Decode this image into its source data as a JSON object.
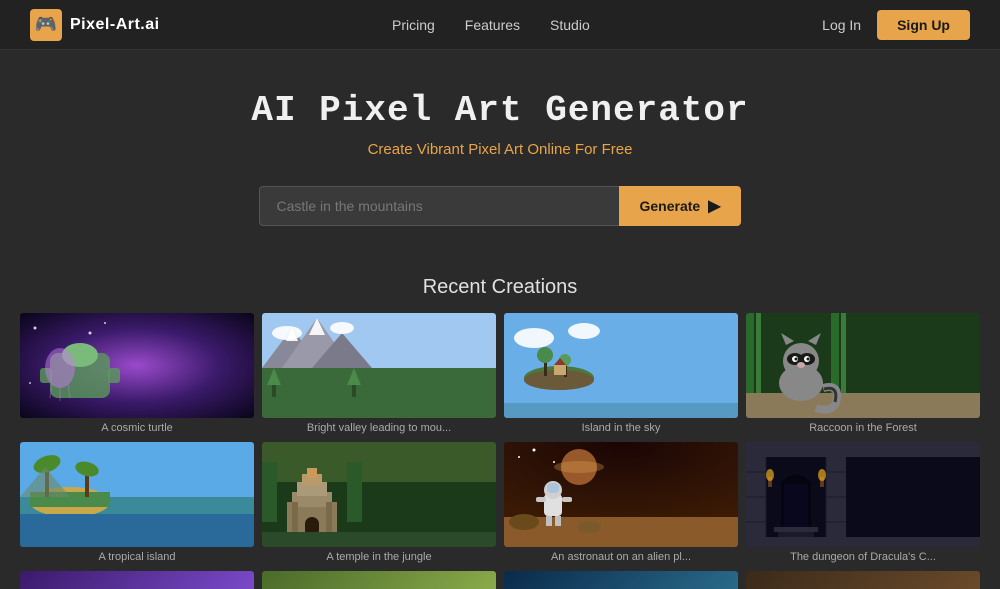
{
  "nav": {
    "logo_text": "Pixel-Art.ai",
    "logo_icon": "🎮",
    "links": [
      {
        "label": "Pricing",
        "id": "pricing"
      },
      {
        "label": "Features",
        "id": "features"
      },
      {
        "label": "Studio",
        "id": "studio"
      }
    ],
    "login_label": "Log In",
    "signup_label": "Sign Up"
  },
  "hero": {
    "title": "AI Pixel Art Generator",
    "subtitle": "Create Vibrant Pixel Art Online For Free",
    "input_placeholder": "Castle in the mountains",
    "generate_label": "Generate"
  },
  "gallery": {
    "title": "Recent Creations",
    "items": [
      {
        "caption": "A cosmic turtle",
        "theme": "cosmic"
      },
      {
        "caption": "Bright valley leading to mou...",
        "theme": "valley"
      },
      {
        "caption": "Island in the sky",
        "theme": "island"
      },
      {
        "caption": "Raccoon in the Forest",
        "theme": "raccoon"
      },
      {
        "caption": "A tropical island",
        "theme": "tropical"
      },
      {
        "caption": "A temple in the jungle",
        "theme": "temple"
      },
      {
        "caption": "An astronaut on an alien pl...",
        "theme": "astronaut"
      },
      {
        "caption": "The dungeon of Dracula's C...",
        "theme": "dungeon"
      }
    ]
  }
}
